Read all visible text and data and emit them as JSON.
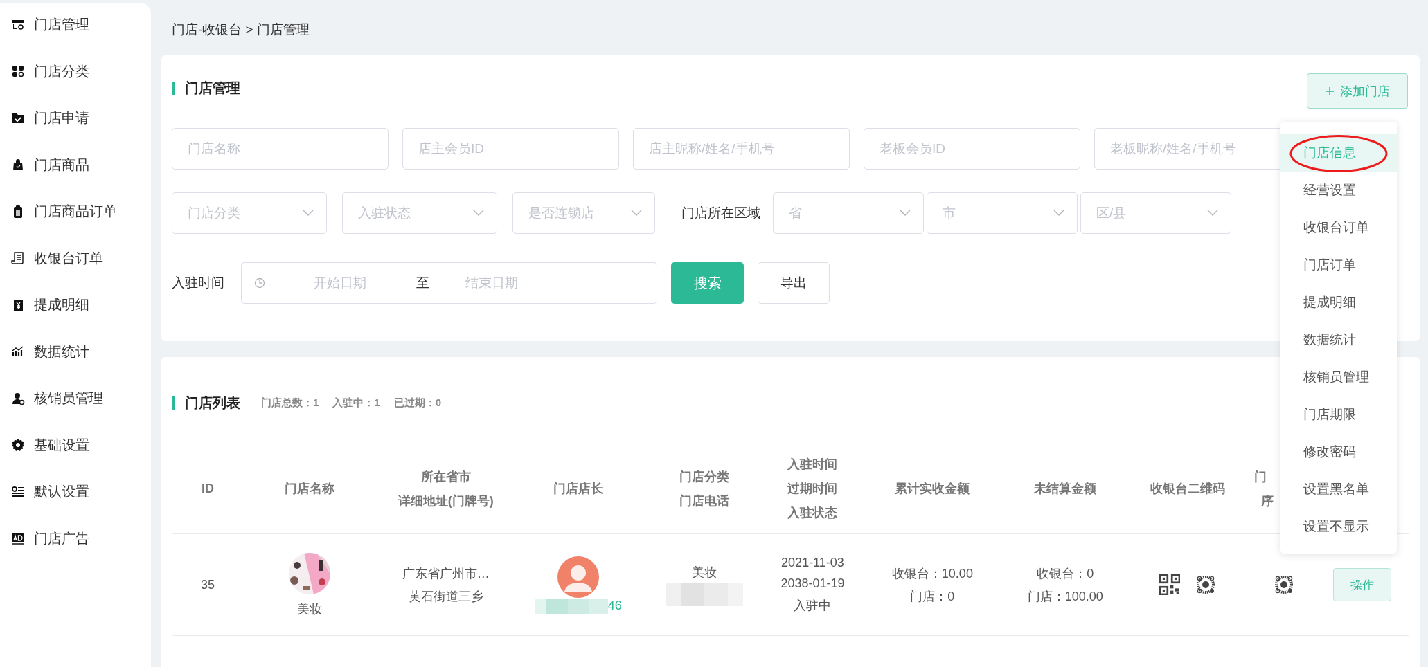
{
  "sidebar": {
    "items": [
      {
        "label": "门店管理"
      },
      {
        "label": "门店分类"
      },
      {
        "label": "门店申请"
      },
      {
        "label": "门店商品"
      },
      {
        "label": "门店商品订单"
      },
      {
        "label": "收银台订单"
      },
      {
        "label": "提成明细"
      },
      {
        "label": "数据统计"
      },
      {
        "label": "核销员管理"
      },
      {
        "label": "基础设置"
      },
      {
        "label": "默认设置"
      },
      {
        "label": "门店广告"
      }
    ]
  },
  "breadcrumb": "门店-收银台 > 门店管理",
  "filter_card": {
    "title": "门店管理",
    "add_button": "添加门店",
    "search_fields": [
      {
        "placeholder": "门店名称"
      },
      {
        "placeholder": "店主会员ID"
      },
      {
        "placeholder": "店主昵称/姓名/手机号"
      },
      {
        "placeholder": "老板会员ID"
      },
      {
        "placeholder": "老板昵称/姓名/手机号"
      }
    ],
    "selects": [
      {
        "placeholder": "门店分类"
      },
      {
        "placeholder": "入驻状态"
      },
      {
        "placeholder": "是否连锁店"
      }
    ],
    "region_label": "门店所在区域",
    "region_selects": [
      {
        "placeholder": "省"
      },
      {
        "placeholder": "市"
      },
      {
        "placeholder": "区/县"
      }
    ],
    "date_label": "入驻时间",
    "date_range": {
      "start_placeholder": "开始日期",
      "separator": "至",
      "end_placeholder": "结束日期"
    },
    "search_button": "搜索",
    "export_button": "导出"
  },
  "list_card": {
    "title": "门店列表",
    "stats": [
      "门店总数：1",
      "入驻中：1",
      "已过期：0"
    ],
    "table": {
      "columns": [
        {
          "lines": [
            "ID"
          ]
        },
        {
          "lines": [
            "门店名称"
          ]
        },
        {
          "lines": [
            "所在省市",
            "详细地址(门牌号)"
          ]
        },
        {
          "lines": [
            "门店店长"
          ]
        },
        {
          "lines": [
            "门店分类",
            "门店电话"
          ]
        },
        {
          "lines": [
            "入驻时间",
            "过期时间",
            "入驻状态"
          ]
        },
        {
          "lines": [
            "累计实收金额"
          ]
        },
        {
          "lines": [
            "未结算金额"
          ]
        },
        {
          "lines": [
            "收银台二维码"
          ]
        },
        {
          "lines": [
            "门",
            "序"
          ]
        },
        {}
      ],
      "rows": [
        {
          "id": "35",
          "store_name": "美妆",
          "address": [
            "广东省广州市…",
            "黄石街道三乡"
          ],
          "owner_phone_tail": "46",
          "category": "美妆",
          "dates": [
            "2021-11-03",
            "2038-01-19",
            "入驻中"
          ],
          "total_received": [
            "收银台：10.00",
            "门店：0"
          ],
          "unsettled": [
            "收银台：0",
            "门店：100.00"
          ],
          "action": "操作"
        }
      ]
    }
  },
  "action_menu": {
    "items": [
      {
        "label": "门店信息",
        "selected": true,
        "circled": true
      },
      {
        "label": "经营设置",
        "selected": false,
        "circled": false
      },
      {
        "label": "收银台订单",
        "selected": false,
        "circled": false
      },
      {
        "label": "门店订单",
        "selected": false,
        "circled": false
      },
      {
        "label": "提成明细",
        "selected": false,
        "circled": false
      },
      {
        "label": "数据统计",
        "selected": false,
        "circled": false
      },
      {
        "label": "核销员管理",
        "selected": false,
        "circled": false
      },
      {
        "label": "门店期限",
        "selected": false,
        "circled": false
      },
      {
        "label": "修改密码",
        "selected": false,
        "circled": false
      },
      {
        "label": "设置黑名单",
        "selected": false,
        "circled": false
      },
      {
        "label": "设置不显示",
        "selected": false,
        "circled": false
      }
    ]
  }
}
